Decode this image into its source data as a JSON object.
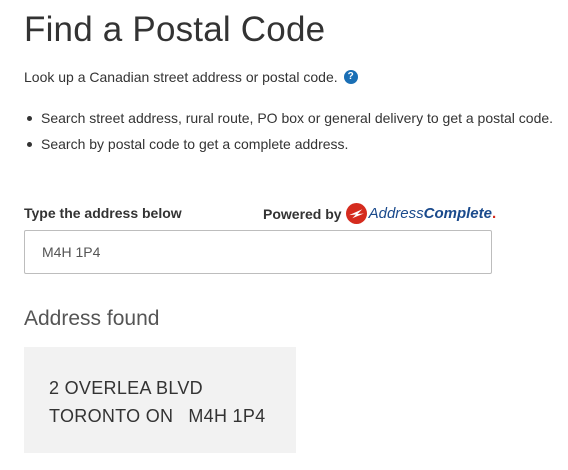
{
  "page": {
    "title": "Find a Postal Code",
    "intro": "Look up a Canadian street address or postal code.",
    "help_icon": "question-circle-icon",
    "help_glyph": "?",
    "tips": [
      "Search street address, rural route, PO box or general delivery to get a postal code.",
      "Search by postal code to get a complete address."
    ]
  },
  "search": {
    "label": "Type the address below",
    "powered_by": "Powered by",
    "brand_logo": "canada-post-logo",
    "brand_address": "Address",
    "brand_complete": "Complete",
    "brand_dot": ".",
    "value": "M4H 1P4"
  },
  "result": {
    "heading": "Address found",
    "street": "2 OVERLEA BLVD",
    "city_province": "TORONTO ON",
    "postal_code": "M4H 1P4"
  },
  "colors": {
    "text": "#333333",
    "help_blue": "#1a6fb5",
    "brand_red": "#d52b1e",
    "brand_blue": "#1a4a8c",
    "result_bg": "#f2f2f2"
  }
}
